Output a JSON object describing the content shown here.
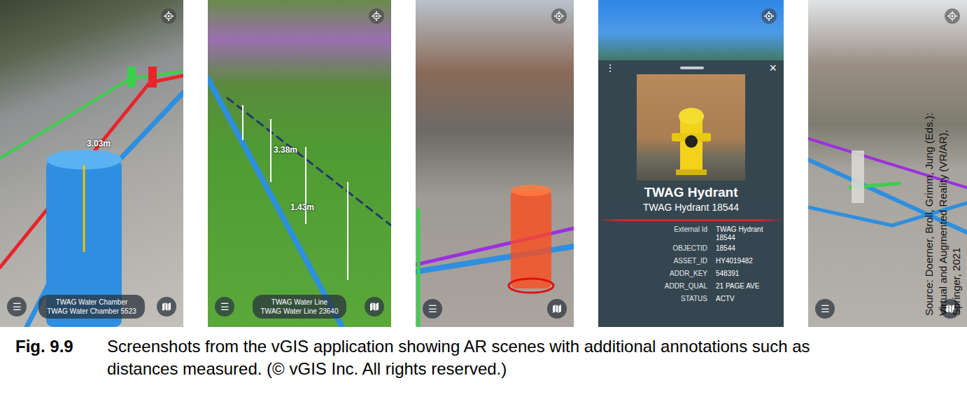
{
  "panels": [
    {
      "kind": "scene",
      "menu": "☰",
      "measurements": [
        "3.03m"
      ],
      "label": {
        "title": "TWAG Water Chamber",
        "subtitle": "TWAG Water Chamber 5523"
      },
      "pipes": [
        {
          "color": "#3ccf4e"
        },
        {
          "color": "#e8252b"
        },
        {
          "color": "#2d8fe0"
        }
      ]
    },
    {
      "kind": "scene",
      "menu": "☰",
      "measurements": [
        "3.38m",
        "1.43m"
      ],
      "label": {
        "title": "TWAG Water Line",
        "subtitle": "TWAG Water Line 23640"
      },
      "pipes": [
        {
          "color": "#2d8fe0"
        },
        {
          "color": "#243a6b"
        }
      ]
    },
    {
      "kind": "scene",
      "menu": "☰",
      "measurements": [],
      "pipes": [
        {
          "color": "#9b30e0"
        },
        {
          "color": "#2d8fe0"
        },
        {
          "color": "#3ccf4e"
        }
      ]
    },
    {
      "kind": "info",
      "measurements": [],
      "pipes": [],
      "card": {
        "more": "⋮",
        "close": "×",
        "title": "TWAG Hydrant",
        "subtitle": "TWAG Hydrant 18544",
        "fields": [
          {
            "label": "External Id",
            "value": "TWAG Hydrant 18544"
          },
          {
            "label": "OBJECTID",
            "value": "18544"
          },
          {
            "label": "ASSET_ID",
            "value": "HY4019482"
          },
          {
            "label": "ADDR_KEY",
            "value": "548391"
          },
          {
            "label": "ADDR_QUAL",
            "value": "21 PAGE AVE"
          },
          {
            "label": "STATUS",
            "value": "ACTV"
          }
        ]
      }
    },
    {
      "kind": "scene",
      "menu": "☰",
      "measurements": [],
      "pipes": [
        {
          "color": "#9b30e0"
        },
        {
          "color": "#2d8fe0"
        },
        {
          "color": "#2d8fe0"
        },
        {
          "color": "#3ccf4e"
        }
      ]
    }
  ],
  "source": [
    "Source: Doerner, Broll, Grimm, Jung (Eds.):",
    "Virtual and Augmented Reality (VR/AR),",
    "Springer, 2021"
  ],
  "caption": {
    "label": "Fig. 9.9",
    "text": "Screenshots from the vGIS application showing AR scenes with additional annotations such as distances measured. (© vGIS Inc. All rights reserved.)"
  }
}
